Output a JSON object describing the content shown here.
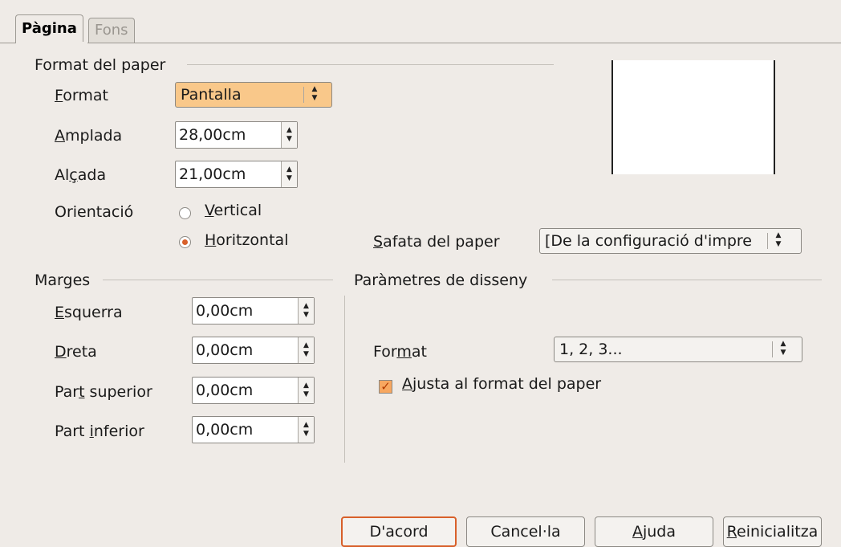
{
  "tabs": [
    {
      "label": "Pàgina",
      "active": true
    },
    {
      "label": "Fons",
      "active": false
    }
  ],
  "paper_format": {
    "title": "Format del paper",
    "format_label_u": "F",
    "format_label_rest": "ormat",
    "format_value": "Pantalla",
    "width_label_u": "A",
    "width_label_rest": "mplada",
    "width_value": "28,00cm",
    "height_label_pre": "Al",
    "height_label_u": "ç",
    "height_label_rest": "ada",
    "height_value": "21,00cm",
    "orientation_label": "Orientació",
    "orientation_options": [
      {
        "u": "V",
        "rest": "ertical",
        "selected": false
      },
      {
        "u": "H",
        "rest": "oritzontal",
        "selected": true
      }
    ],
    "tray_label_u": "S",
    "tray_label_rest": "afata del paper",
    "tray_value": "[De la configuració d'impre"
  },
  "margins": {
    "title": "Marges",
    "left_label_u": "E",
    "left_label_rest": "squerra",
    "left_value": "0,00cm",
    "right_label_u": "D",
    "right_label_rest": "reta",
    "right_value": "0,00cm",
    "top_label_pre": "Par",
    "top_label_u": "t",
    "top_label_rest": " superior",
    "top_value": "0,00cm",
    "bottom_label_pre": "Part ",
    "bottom_label_u": "i",
    "bottom_label_rest": "nferior",
    "bottom_value": "0,00cm"
  },
  "layout": {
    "title": "Paràmetres de disseny",
    "format_label_pre": "For",
    "format_label_u": "m",
    "format_label_rest": "at",
    "format_value": "1, 2, 3...",
    "fit_label_u": "A",
    "fit_label_rest": "justa al format del paper",
    "fit_checked": true
  },
  "buttons": {
    "ok": "D'acord",
    "cancel": "Cancel·la",
    "help_u": "A",
    "help_rest": "juda",
    "reset_u": "R",
    "reset_rest": "einicialitza"
  },
  "colors": {
    "accent": "#d8602a",
    "background": "#efebe7"
  }
}
